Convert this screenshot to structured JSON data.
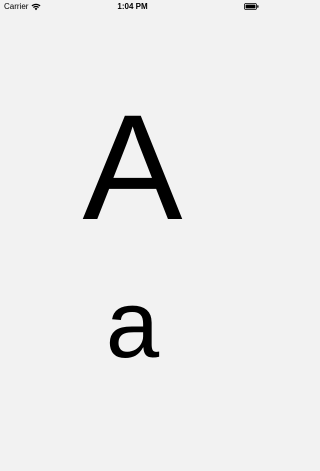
{
  "status_bar": {
    "carrier": "Carrier",
    "time": "1:04 PM",
    "wifi_icon": "wifi-icon",
    "battery_icon": "battery-icon"
  },
  "main": {
    "uppercase_letter": "A",
    "lowercase_letter": "a"
  }
}
